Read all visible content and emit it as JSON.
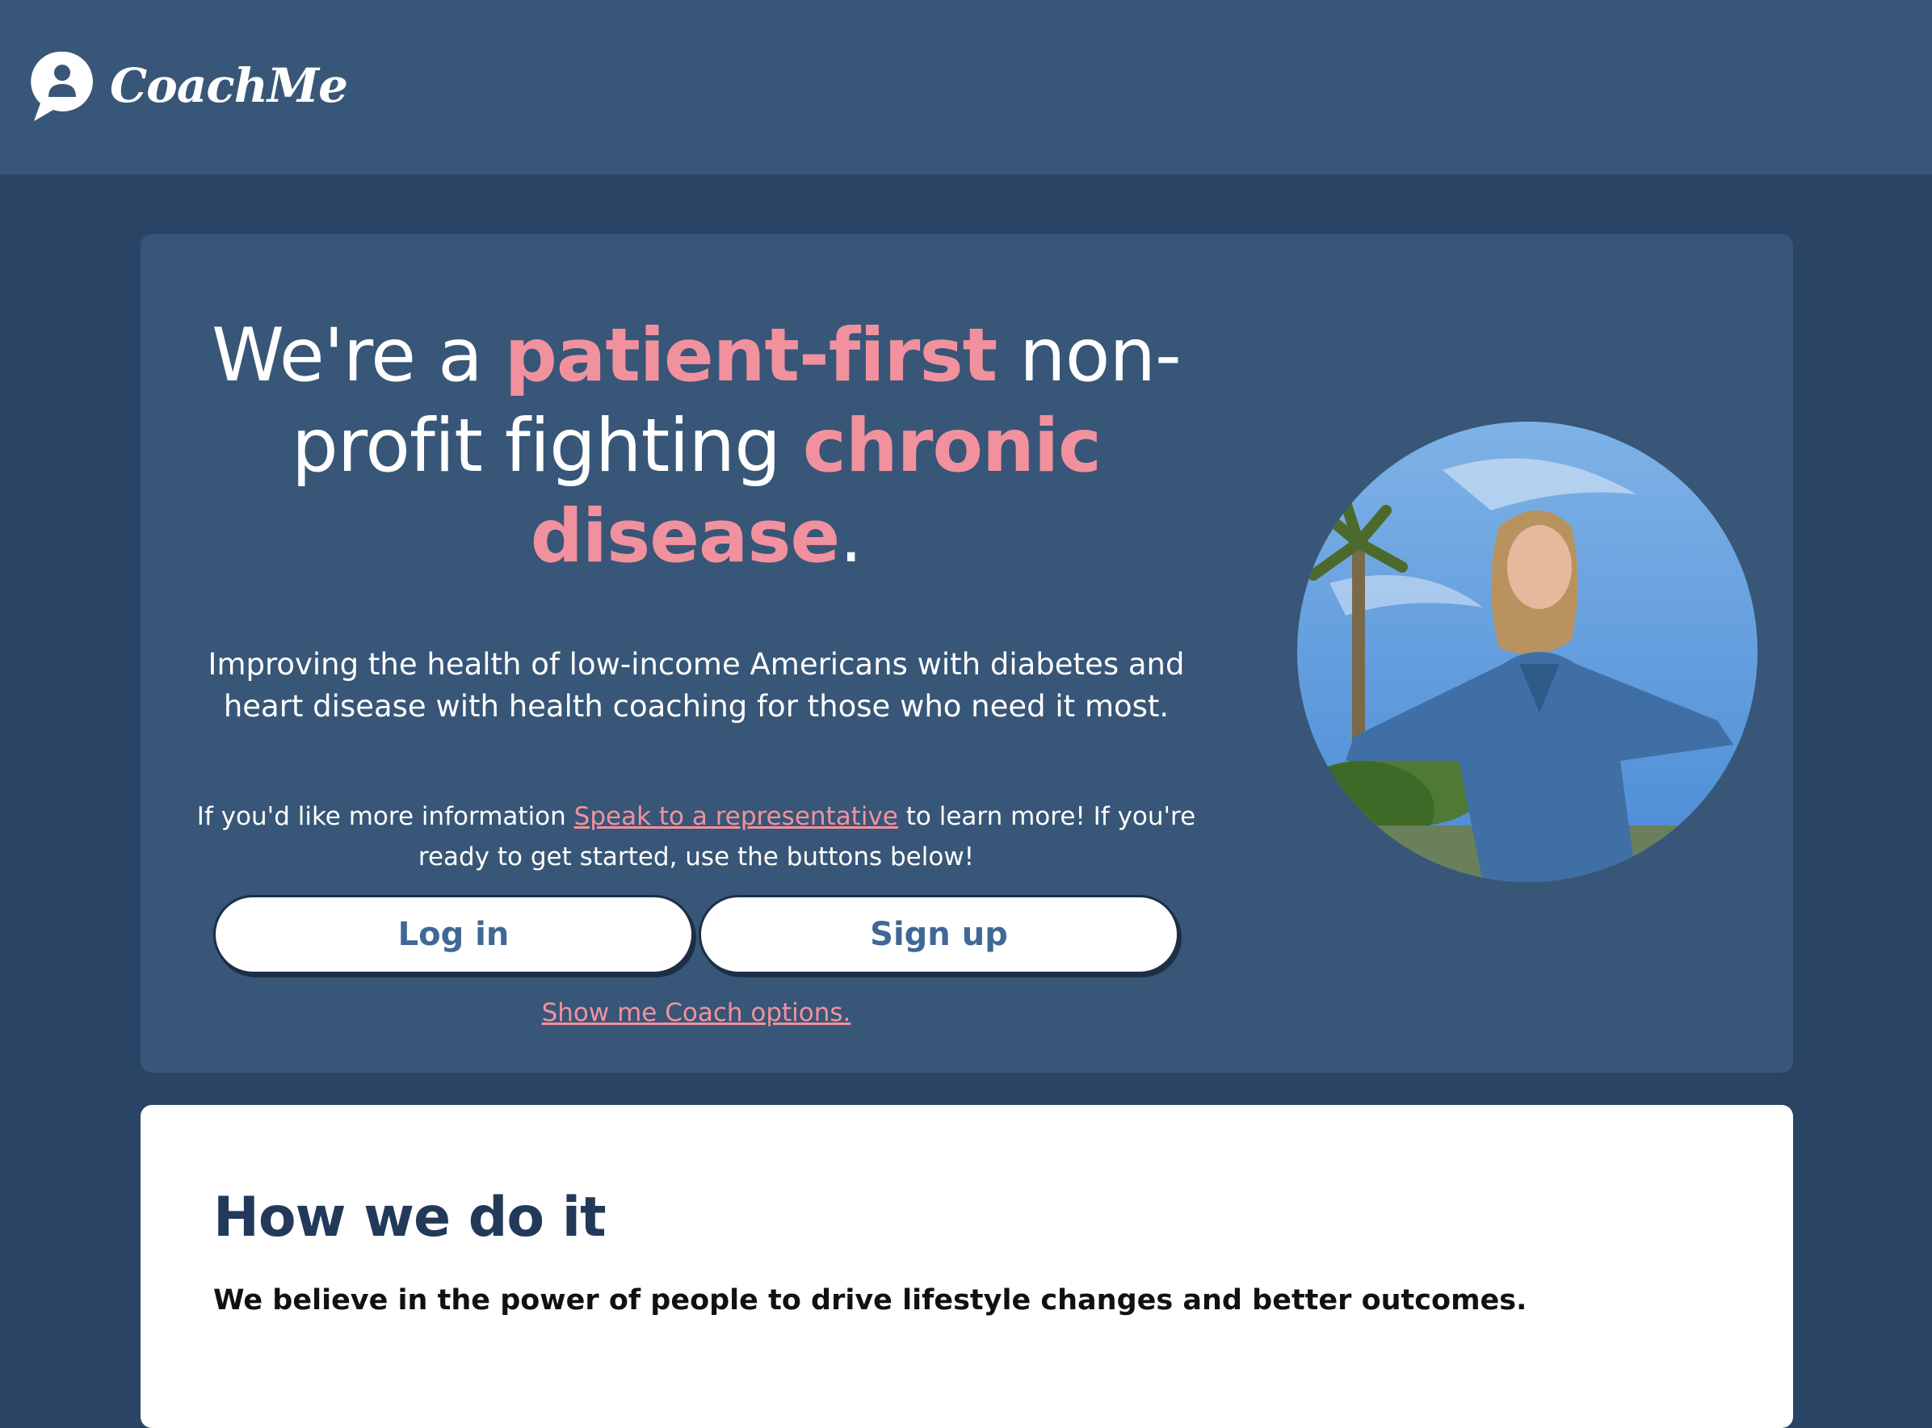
{
  "header": {
    "brand": "CoachMe",
    "logo_icon": "chat-bubble-person-icon"
  },
  "hero": {
    "headline": {
      "part1": "We're a ",
      "highlight1": "patient-first",
      "part2": " non-profit fighting ",
      "highlight2": "chronic disease",
      "part3": "."
    },
    "subheading": "Improving the health of low-income Americans with diabetes and heart disease with health coaching for those who need it most.",
    "info": {
      "before": "If you'd like more information ",
      "link": "Speak to a representative",
      "after": " to learn more! If you're ready to get started, use the buttons below!"
    },
    "buttons": {
      "login": "Log in",
      "signup": "Sign up"
    },
    "coach_link": "Show me Coach options.",
    "photo_icon": "woman-palm-trees-photo"
  },
  "how": {
    "title": "How we do it",
    "text": "We believe in the power of people to drive lifestyle changes and better outcomes."
  },
  "colors": {
    "background": "#2a4466",
    "panel": "#385677",
    "accent_pink": "#f2919e",
    "button_text": "#3f6896",
    "dark_heading": "#23395a"
  }
}
